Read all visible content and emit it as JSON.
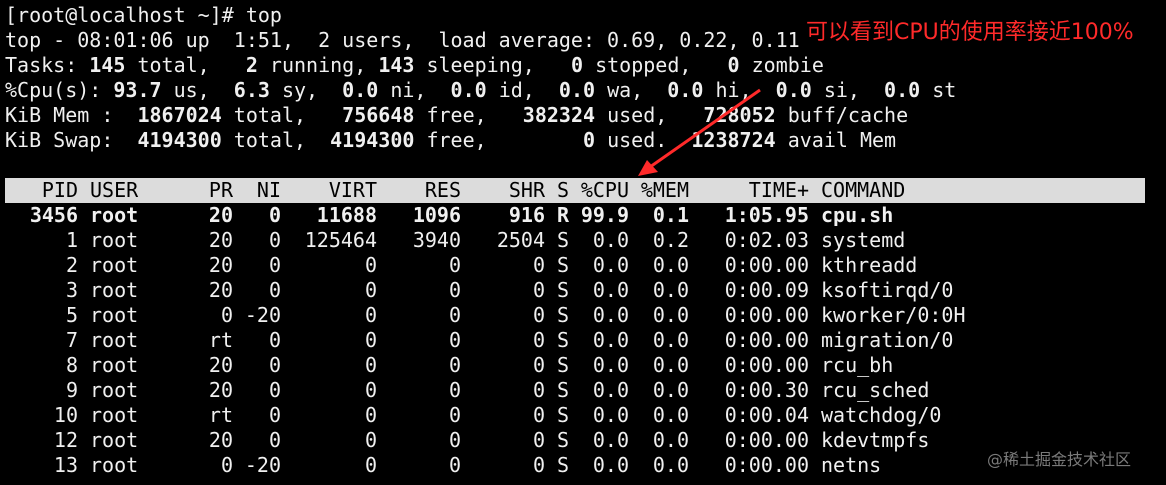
{
  "prompt": "[root@localhost ~]# top",
  "summary": {
    "uptime_line": "top - 08:01:06 up  1:51,  2 users,  load average: 0.69, 0.22, 0.11",
    "tasks": {
      "label": "Tasks: ",
      "total": "145",
      "total_lbl": " total,   ",
      "running": "2",
      "running_lbl": " running, ",
      "sleeping": "143",
      "sleeping_lbl": " sleeping,   ",
      "stopped": "0",
      "stopped_lbl": " stopped,   ",
      "zombie": "0",
      "zombie_lbl": " zombie"
    },
    "cpu": {
      "label": "%Cpu(s): ",
      "us": "93.7",
      "us_lbl": " us,  ",
      "sy": "6.3",
      "sy_lbl": " sy,  ",
      "ni": "0.0",
      "ni_lbl": " ni,  ",
      "id": "0.0",
      "id_lbl": " id,  ",
      "wa": "0.0",
      "wa_lbl": " wa,  ",
      "hi": "0.0",
      "hi_lbl": " hi,  ",
      "si": "0.0",
      "si_lbl": " si,  ",
      "st": "0.0",
      "st_lbl": " st"
    },
    "mem": {
      "label": "KiB Mem :  ",
      "total": "1867024",
      "total_lbl": " total,   ",
      "free": "756648",
      "free_lbl": " free,   ",
      "used": "382324",
      "used_lbl": " used,   ",
      "buff": "728052",
      "buff_lbl": " buff/cache"
    },
    "swap": {
      "label": "KiB Swap:  ",
      "total": "4194300",
      "total_lbl": " total,  ",
      "free": "4194300",
      "free_lbl": " free,        ",
      "used": "0",
      "used_lbl": " used.  ",
      "avail": "1238724",
      "avail_lbl": " avail Mem"
    }
  },
  "columns": [
    "PID",
    "USER",
    "PR",
    "NI",
    "VIRT",
    "RES",
    "SHR",
    "S",
    "%CPU",
    "%MEM",
    "TIME+",
    "COMMAND"
  ],
  "processes": [
    [
      "3456",
      "root",
      "20",
      "0",
      "11688",
      "1096",
      "916",
      "R",
      "99.9",
      "0.1",
      "1:05.95",
      "cpu.sh"
    ],
    [
      "1",
      "root",
      "20",
      "0",
      "125464",
      "3940",
      "2504",
      "S",
      "0.0",
      "0.2",
      "0:02.03",
      "systemd"
    ],
    [
      "2",
      "root",
      "20",
      "0",
      "0",
      "0",
      "0",
      "S",
      "0.0",
      "0.0",
      "0:00.00",
      "kthreadd"
    ],
    [
      "3",
      "root",
      "20",
      "0",
      "0",
      "0",
      "0",
      "S",
      "0.0",
      "0.0",
      "0:00.09",
      "ksoftirqd/0"
    ],
    [
      "5",
      "root",
      "0",
      "-20",
      "0",
      "0",
      "0",
      "S",
      "0.0",
      "0.0",
      "0:00.00",
      "kworker/0:0H"
    ],
    [
      "7",
      "root",
      "rt",
      "0",
      "0",
      "0",
      "0",
      "S",
      "0.0",
      "0.0",
      "0:00.00",
      "migration/0"
    ],
    [
      "8",
      "root",
      "20",
      "0",
      "0",
      "0",
      "0",
      "S",
      "0.0",
      "0.0",
      "0:00.00",
      "rcu_bh"
    ],
    [
      "9",
      "root",
      "20",
      "0",
      "0",
      "0",
      "0",
      "S",
      "0.0",
      "0.0",
      "0:00.30",
      "rcu_sched"
    ],
    [
      "10",
      "root",
      "rt",
      "0",
      "0",
      "0",
      "0",
      "S",
      "0.0",
      "0.0",
      "0:00.04",
      "watchdog/0"
    ],
    [
      "12",
      "root",
      "20",
      "0",
      "0",
      "0",
      "0",
      "S",
      "0.0",
      "0.0",
      "0:00.00",
      "kdevtmpfs"
    ],
    [
      "13",
      "root",
      "0",
      "-20",
      "0",
      "0",
      "0",
      "S",
      "0.0",
      "0.0",
      "0:00.00",
      "netns"
    ]
  ],
  "annotation": "可以看到CPU的使用率接近100%",
  "annotation_color": "#ff2a2a",
  "watermark": "@稀土掘金技术社区"
}
